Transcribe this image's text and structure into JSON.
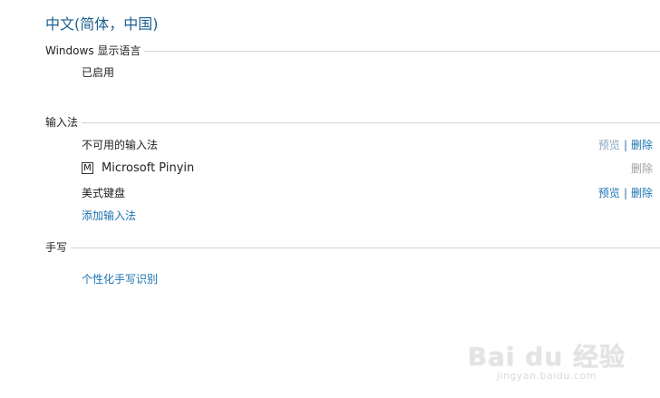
{
  "page": {
    "title": "中文(简体，中国)"
  },
  "display_language": {
    "header": "Windows 显示语言",
    "status": "已启用"
  },
  "input_methods": {
    "header": "输入法",
    "unavailable": {
      "label": "不可用的输入法",
      "preview": "预览",
      "delete": "删除"
    },
    "items": [
      {
        "icon": "M",
        "name": "Microsoft Pinyin",
        "delete": "删除"
      },
      {
        "name": "美式键盘",
        "preview": "预览",
        "delete": "删除"
      }
    ],
    "add_link": "添加输入法"
  },
  "handwriting": {
    "header": "手写",
    "personalize_link": "个性化手写识别"
  },
  "watermark": {
    "logo": "Bai du 经验",
    "url": "jingyan.baidu.com"
  },
  "colors": {
    "title": "#1b5f8e",
    "link": "#1b73b3",
    "rule": "#d2d2d2"
  }
}
